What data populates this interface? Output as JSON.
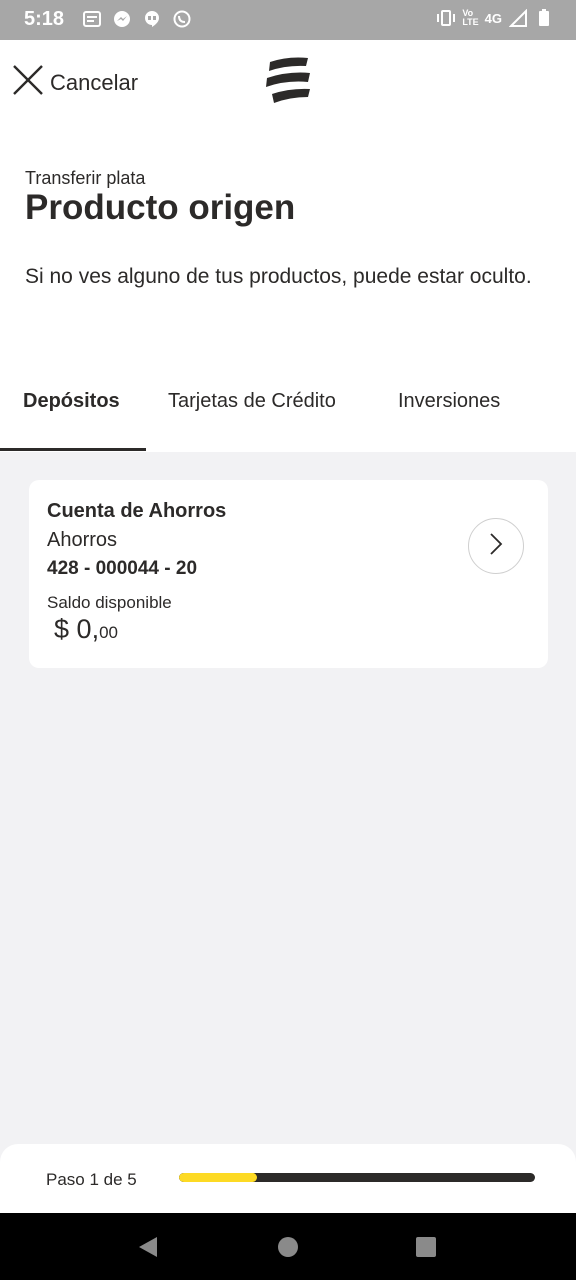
{
  "status_bar": {
    "time": "5:18",
    "network_top": "Vo",
    "network_bottom": "LTE",
    "network_type": "4G",
    "icons": [
      "message-icon",
      "messenger-icon",
      "hangouts-icon",
      "whatsapp-icon",
      "vibrate-icon",
      "signal-icon",
      "battery-icon"
    ]
  },
  "top_bar": {
    "cancel_label": "Cancelar",
    "logo_icon": "bancolombia-logo"
  },
  "header": {
    "eyebrow": "Transferir plata",
    "title": "Producto origen",
    "hint": "Si no ves alguno de tus productos, puede estar oculto."
  },
  "tabs": [
    {
      "label": "Depósitos",
      "active": true
    },
    {
      "label": "Tarjetas de Crédito",
      "active": false
    },
    {
      "label": "Inversiones",
      "active": false
    }
  ],
  "products": [
    {
      "name": "Cuenta de Ahorros",
      "type": "Ahorros",
      "number": "428 - 000044 - 20",
      "balance_label": "Saldo disponible",
      "balance_currency": "$",
      "balance_integer": "0,",
      "balance_cents": "00"
    }
  ],
  "progress": {
    "label": "Paso 1 de 5",
    "current_step": 1,
    "total_steps": 5,
    "fraction": 0.22,
    "fill_color": "#fdda24",
    "track_color": "#2c2a29"
  },
  "nav_bar": {
    "icons": [
      "back-icon",
      "home-icon",
      "recents-icon"
    ]
  }
}
